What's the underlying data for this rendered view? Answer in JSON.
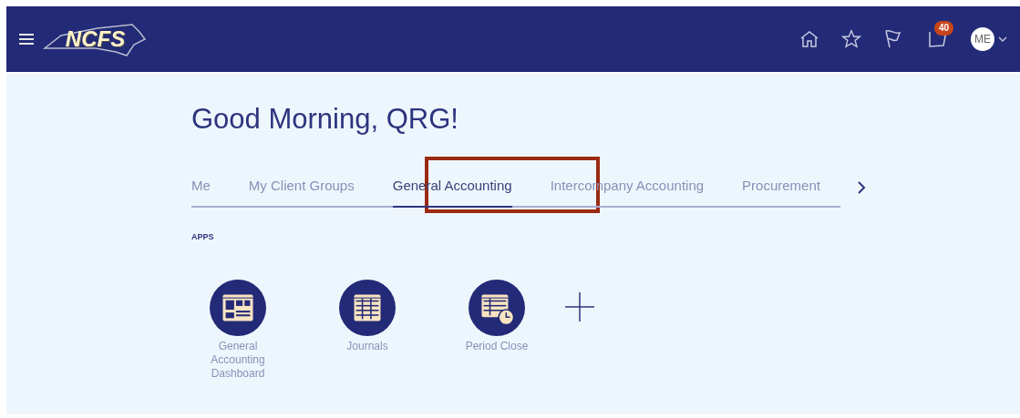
{
  "header": {
    "logo_text": "NCFS",
    "notifications_count": "40",
    "avatar_initials": "ME"
  },
  "greeting": "Good Morning, QRG!",
  "tabs": [
    {
      "label": "Me",
      "selected": false
    },
    {
      "label": "My Client Groups",
      "selected": false
    },
    {
      "label": "General Accounting",
      "selected": true
    },
    {
      "label": "Intercompany Accounting",
      "selected": false
    },
    {
      "label": "Procurement",
      "selected": false
    }
  ],
  "section_title": "APPS",
  "apps": [
    {
      "label": "General Accounting Dashboard",
      "kind": "dashboard"
    },
    {
      "label": "Journals",
      "kind": "table"
    },
    {
      "label": "Period Close",
      "kind": "clock"
    }
  ],
  "highlight": {
    "on": true
  }
}
